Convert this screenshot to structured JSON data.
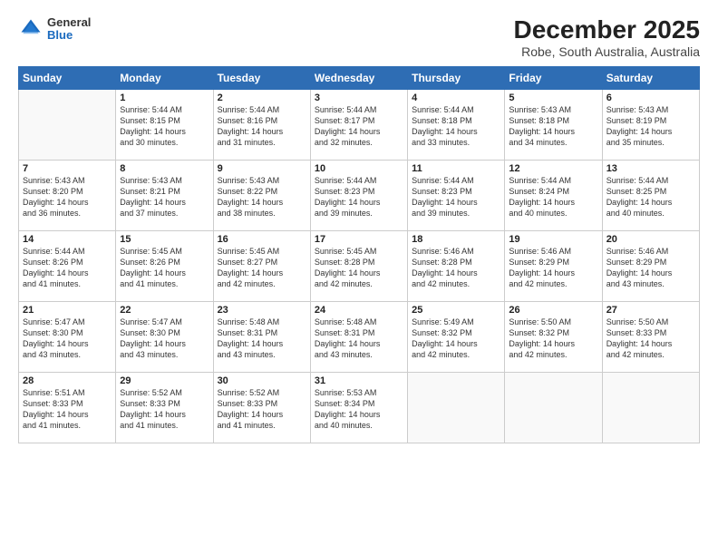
{
  "header": {
    "logo_general": "General",
    "logo_blue": "Blue",
    "main_title": "December 2025",
    "subtitle": "Robe, South Australia, Australia"
  },
  "days_of_week": [
    "Sunday",
    "Monday",
    "Tuesday",
    "Wednesday",
    "Thursday",
    "Friday",
    "Saturday"
  ],
  "weeks": [
    [
      {
        "day": "",
        "info": ""
      },
      {
        "day": "1",
        "info": "Sunrise: 5:44 AM\nSunset: 8:15 PM\nDaylight: 14 hours\nand 30 minutes."
      },
      {
        "day": "2",
        "info": "Sunrise: 5:44 AM\nSunset: 8:16 PM\nDaylight: 14 hours\nand 31 minutes."
      },
      {
        "day": "3",
        "info": "Sunrise: 5:44 AM\nSunset: 8:17 PM\nDaylight: 14 hours\nand 32 minutes."
      },
      {
        "day": "4",
        "info": "Sunrise: 5:44 AM\nSunset: 8:18 PM\nDaylight: 14 hours\nand 33 minutes."
      },
      {
        "day": "5",
        "info": "Sunrise: 5:43 AM\nSunset: 8:18 PM\nDaylight: 14 hours\nand 34 minutes."
      },
      {
        "day": "6",
        "info": "Sunrise: 5:43 AM\nSunset: 8:19 PM\nDaylight: 14 hours\nand 35 minutes."
      }
    ],
    [
      {
        "day": "7",
        "info": "Sunrise: 5:43 AM\nSunset: 8:20 PM\nDaylight: 14 hours\nand 36 minutes."
      },
      {
        "day": "8",
        "info": "Sunrise: 5:43 AM\nSunset: 8:21 PM\nDaylight: 14 hours\nand 37 minutes."
      },
      {
        "day": "9",
        "info": "Sunrise: 5:43 AM\nSunset: 8:22 PM\nDaylight: 14 hours\nand 38 minutes."
      },
      {
        "day": "10",
        "info": "Sunrise: 5:44 AM\nSunset: 8:23 PM\nDaylight: 14 hours\nand 39 minutes."
      },
      {
        "day": "11",
        "info": "Sunrise: 5:44 AM\nSunset: 8:23 PM\nDaylight: 14 hours\nand 39 minutes."
      },
      {
        "day": "12",
        "info": "Sunrise: 5:44 AM\nSunset: 8:24 PM\nDaylight: 14 hours\nand 40 minutes."
      },
      {
        "day": "13",
        "info": "Sunrise: 5:44 AM\nSunset: 8:25 PM\nDaylight: 14 hours\nand 40 minutes."
      }
    ],
    [
      {
        "day": "14",
        "info": "Sunrise: 5:44 AM\nSunset: 8:26 PM\nDaylight: 14 hours\nand 41 minutes."
      },
      {
        "day": "15",
        "info": "Sunrise: 5:45 AM\nSunset: 8:26 PM\nDaylight: 14 hours\nand 41 minutes."
      },
      {
        "day": "16",
        "info": "Sunrise: 5:45 AM\nSunset: 8:27 PM\nDaylight: 14 hours\nand 42 minutes."
      },
      {
        "day": "17",
        "info": "Sunrise: 5:45 AM\nSunset: 8:28 PM\nDaylight: 14 hours\nand 42 minutes."
      },
      {
        "day": "18",
        "info": "Sunrise: 5:46 AM\nSunset: 8:28 PM\nDaylight: 14 hours\nand 42 minutes."
      },
      {
        "day": "19",
        "info": "Sunrise: 5:46 AM\nSunset: 8:29 PM\nDaylight: 14 hours\nand 42 minutes."
      },
      {
        "day": "20",
        "info": "Sunrise: 5:46 AM\nSunset: 8:29 PM\nDaylight: 14 hours\nand 43 minutes."
      }
    ],
    [
      {
        "day": "21",
        "info": "Sunrise: 5:47 AM\nSunset: 8:30 PM\nDaylight: 14 hours\nand 43 minutes."
      },
      {
        "day": "22",
        "info": "Sunrise: 5:47 AM\nSunset: 8:30 PM\nDaylight: 14 hours\nand 43 minutes."
      },
      {
        "day": "23",
        "info": "Sunrise: 5:48 AM\nSunset: 8:31 PM\nDaylight: 14 hours\nand 43 minutes."
      },
      {
        "day": "24",
        "info": "Sunrise: 5:48 AM\nSunset: 8:31 PM\nDaylight: 14 hours\nand 43 minutes."
      },
      {
        "day": "25",
        "info": "Sunrise: 5:49 AM\nSunset: 8:32 PM\nDaylight: 14 hours\nand 42 minutes."
      },
      {
        "day": "26",
        "info": "Sunrise: 5:50 AM\nSunset: 8:32 PM\nDaylight: 14 hours\nand 42 minutes."
      },
      {
        "day": "27",
        "info": "Sunrise: 5:50 AM\nSunset: 8:33 PM\nDaylight: 14 hours\nand 42 minutes."
      }
    ],
    [
      {
        "day": "28",
        "info": "Sunrise: 5:51 AM\nSunset: 8:33 PM\nDaylight: 14 hours\nand 41 minutes."
      },
      {
        "day": "29",
        "info": "Sunrise: 5:52 AM\nSunset: 8:33 PM\nDaylight: 14 hours\nand 41 minutes."
      },
      {
        "day": "30",
        "info": "Sunrise: 5:52 AM\nSunset: 8:33 PM\nDaylight: 14 hours\nand 41 minutes."
      },
      {
        "day": "31",
        "info": "Sunrise: 5:53 AM\nSunset: 8:34 PM\nDaylight: 14 hours\nand 40 minutes."
      },
      {
        "day": "",
        "info": ""
      },
      {
        "day": "",
        "info": ""
      },
      {
        "day": "",
        "info": ""
      }
    ]
  ]
}
